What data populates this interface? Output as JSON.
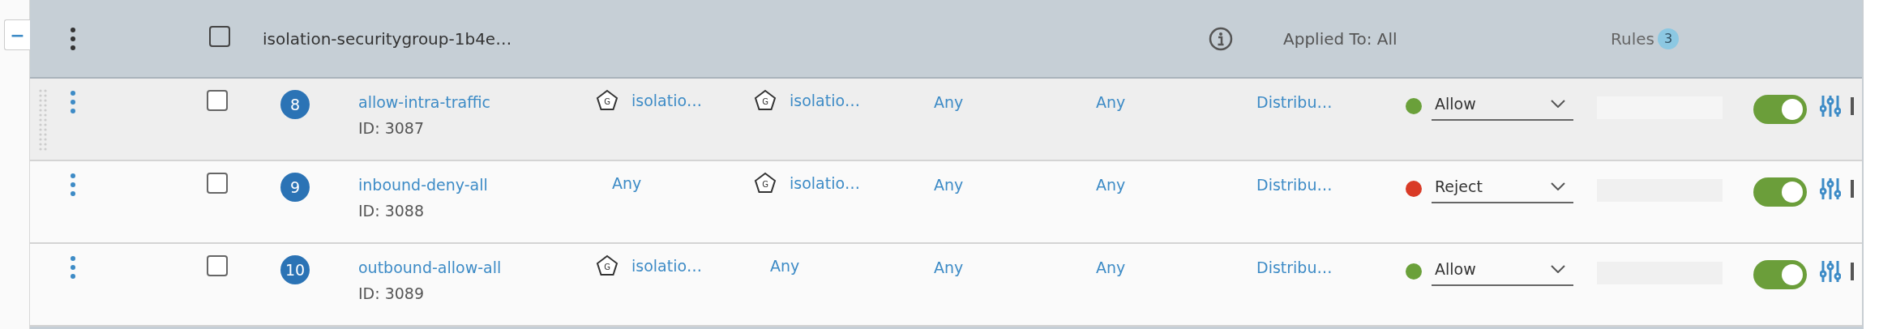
{
  "collapse_button": {
    "label": "−"
  },
  "header": {
    "checked": false,
    "title": "isolation-securitygroup-1b4e…",
    "applied_to": "Applied To: All",
    "rules_label": "Rules",
    "rules_count": "3"
  },
  "rows": [
    {
      "hovered": true,
      "checked": false,
      "number": "8",
      "name": "allow-intra-traffic",
      "id": "ID: 3087",
      "sources": {
        "kind": "group",
        "icon_letter": "G",
        "text": "isolatio…"
      },
      "destinations": {
        "kind": "group",
        "icon_letter": "G",
        "text": "isolatio…"
      },
      "services": "Any",
      "profiles": "Any",
      "applied_to": "Distribu…",
      "action": {
        "text": "Allow",
        "color": "#6aa03a"
      },
      "enabled": true
    },
    {
      "hovered": false,
      "checked": false,
      "number": "9",
      "name": "inbound-deny-all",
      "id": "ID: 3088",
      "sources": {
        "kind": "any",
        "text": "Any"
      },
      "destinations": {
        "kind": "group",
        "icon_letter": "G",
        "text": "isolatio…"
      },
      "services": "Any",
      "profiles": "Any",
      "applied_to": "Distribu…",
      "action": {
        "text": "Reject",
        "color": "#d93a26"
      },
      "enabled": true
    },
    {
      "hovered": false,
      "checked": false,
      "number": "10",
      "name": "outbound-allow-all",
      "id": "ID: 3089",
      "sources": {
        "kind": "group",
        "icon_letter": "G",
        "text": "isolatio…"
      },
      "destinations": {
        "kind": "any",
        "text": "Any"
      },
      "services": "Any",
      "profiles": "Any",
      "applied_to": "Distribu…",
      "action": {
        "text": "Allow",
        "color": "#6aa03a"
      },
      "enabled": true
    }
  ]
}
